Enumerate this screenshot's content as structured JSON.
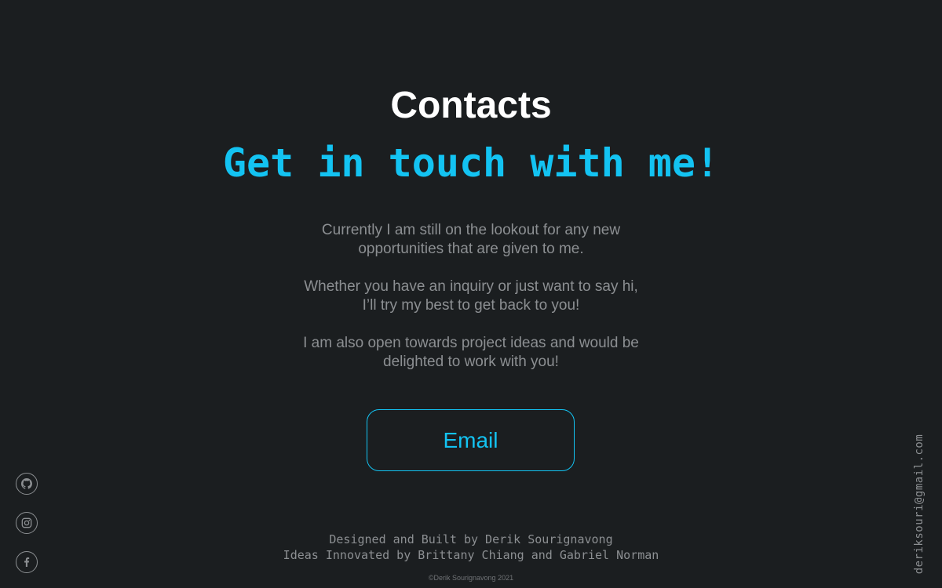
{
  "contact": {
    "title": "Contacts",
    "subtitle": "Get in touch with me!",
    "paragraphs": [
      "Currently I am still on the lookout for any new opportunities that are given to me.",
      "Whether you have an inquiry or just want to say hi, I’ll try my best to get back to you!",
      "I am also open towards project ideas and would be delighted to work with you!"
    ],
    "button_label": "Email"
  },
  "social": {
    "icons": [
      "github-icon",
      "instagram-icon",
      "facebook-icon"
    ]
  },
  "side": {
    "email": "deriksouri@gmail.com"
  },
  "footer": {
    "line1": "Designed and Built by Derik Sourignavong",
    "line2": "Ideas Innovated by Brittany Chiang and Gabriel Norman",
    "copyright": "©Derik Sourignavong 2021"
  },
  "colors": {
    "background": "#1b1e20",
    "accent": "#13c3f2",
    "text_muted": "#8c8f92",
    "heading": "#ffffff"
  }
}
